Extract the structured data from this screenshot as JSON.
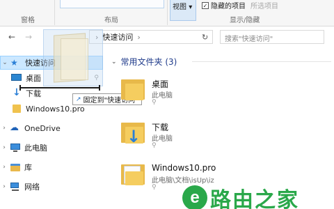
{
  "ribbon": {
    "groups": {
      "panes": "窗格",
      "layout": "布局",
      "show_hide": "显示/隐藏"
    },
    "view_button": "视图",
    "hidden_items_label": "隐藏的项目",
    "hidden_items_checked": true,
    "selected_items_label": "所选项目"
  },
  "address": {
    "back": "←",
    "forward": "→",
    "path": "快速访问",
    "search_placeholder": "搜索\"快速访问\""
  },
  "nav": {
    "quick_access": "快速访问",
    "items": [
      {
        "label": "桌面"
      },
      {
        "label": "下载"
      },
      {
        "label": "Windows10.pro"
      }
    ],
    "onedrive": "OneDrive",
    "this_pc": "此电脑",
    "libraries": "库",
    "network": "网络"
  },
  "drag": {
    "tooltip": "固定到\"快速访问\""
  },
  "content": {
    "group_title": "常用文件夹 (3)",
    "items": [
      {
        "name": "桌面",
        "location": "此电脑"
      },
      {
        "name": "下载",
        "location": "此电脑"
      },
      {
        "name": "Windows10.pro",
        "location": "此电脑\\文档\\isUp\\iz"
      }
    ]
  },
  "watermark": {
    "text": "路由之家"
  },
  "colors": {
    "selection_bg": "#cce8ff",
    "folder": "#f5cd5f",
    "watermark": "#2aa84a"
  }
}
